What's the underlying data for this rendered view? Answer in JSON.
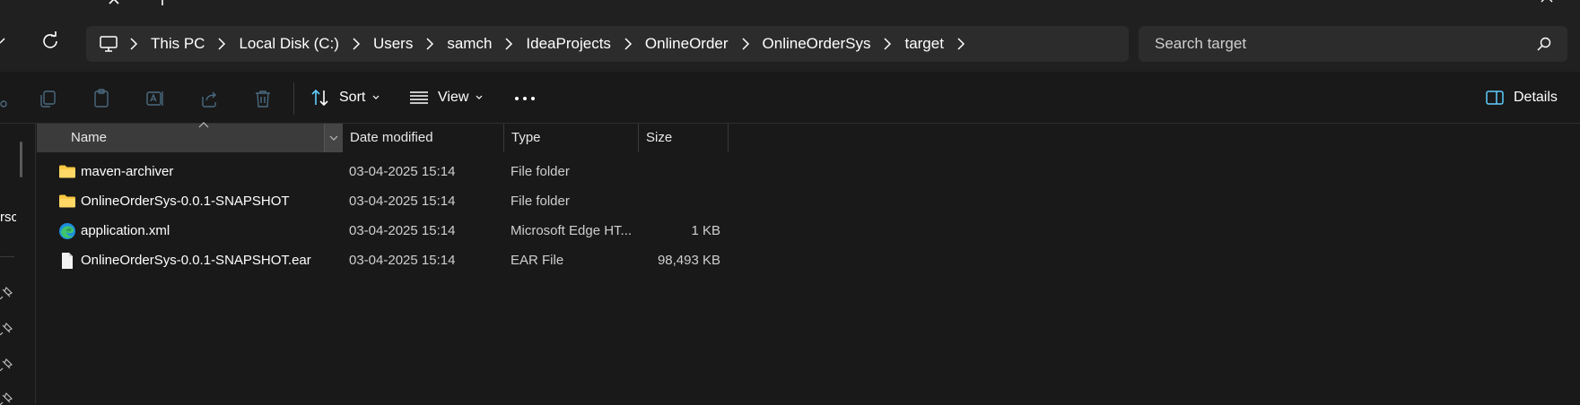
{
  "breadcrumb": {
    "items": [
      "This PC",
      "Local Disk (C:)",
      "Users",
      "samch",
      "IdeaProjects",
      "OnlineOrder",
      "OnlineOrderSys",
      "target"
    ]
  },
  "search": {
    "placeholder": "Search target"
  },
  "commandbar": {
    "sort_label": "Sort",
    "view_label": "View",
    "details_label": "Details"
  },
  "navpane": {
    "partial_text": "rsc"
  },
  "columns": {
    "name": "Name",
    "date": "Date modified",
    "type": "Type",
    "size": "Size"
  },
  "files": [
    {
      "name": "maven-archiver",
      "date": "03-04-2025 15:14",
      "type": "File folder",
      "size": "",
      "icon": "folder-icon"
    },
    {
      "name": "OnlineOrderSys-0.0.1-SNAPSHOT",
      "date": "03-04-2025 15:14",
      "type": "File folder",
      "size": "",
      "icon": "folder-icon"
    },
    {
      "name": "application.xml",
      "date": "03-04-2025 15:14",
      "type": "Microsoft Edge HT...",
      "size": "1 KB",
      "icon": "edge-icon"
    },
    {
      "name": "OnlineOrderSys-0.0.1-SNAPSHOT.ear",
      "date": "03-04-2025 15:14",
      "type": "EAR File",
      "size": "98,493 KB",
      "icon": "file-icon"
    }
  ],
  "colors": {
    "background": "#191919",
    "toolbar": "#202020",
    "field": "#2c2c2c",
    "accent": "#60cdff",
    "folder": "#f8c842"
  }
}
